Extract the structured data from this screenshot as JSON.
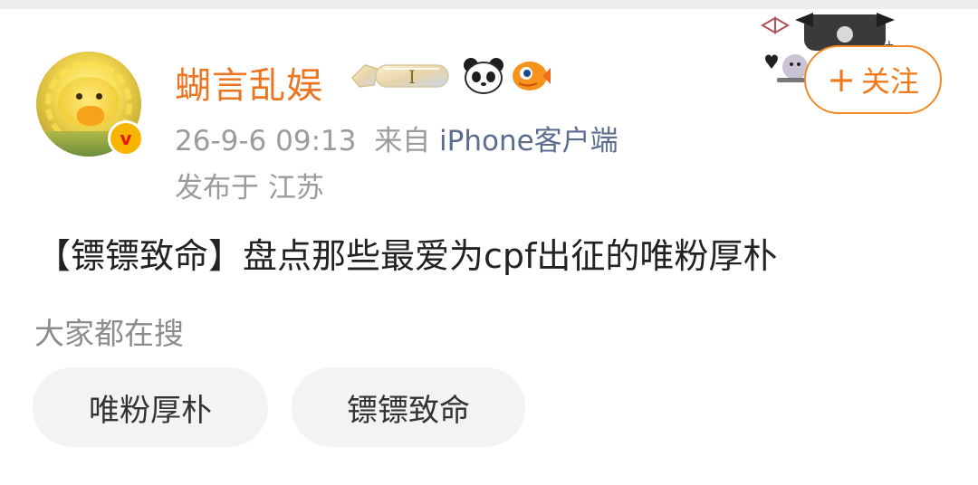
{
  "post": {
    "author": {
      "name": "蝴言乱娱",
      "crystal_badge_letter": "I"
    },
    "meta": {
      "time": "26-9-6 09:13",
      "from_label": "来自",
      "client": "iPhone客户端",
      "location": "发布于 江苏"
    },
    "follow_label": "关注",
    "text": "【镖镖致命】盘点那些最爱为cpf出征的唯粉厚朴"
  },
  "search": {
    "label": "大家都在搜",
    "tags": [
      "唯粉厚朴",
      "镖镖致命"
    ]
  },
  "colors": {
    "username": "#ec7521",
    "follow_accent": "#f08a24",
    "client_link": "#5b6c8f",
    "verified_badge": "#f8b500"
  },
  "icons": [
    "verified-v-icon",
    "crystal-level-badge-icon",
    "panda-icon",
    "fish-icon",
    "plus-icon",
    "cartoon-decoration-icon"
  ]
}
